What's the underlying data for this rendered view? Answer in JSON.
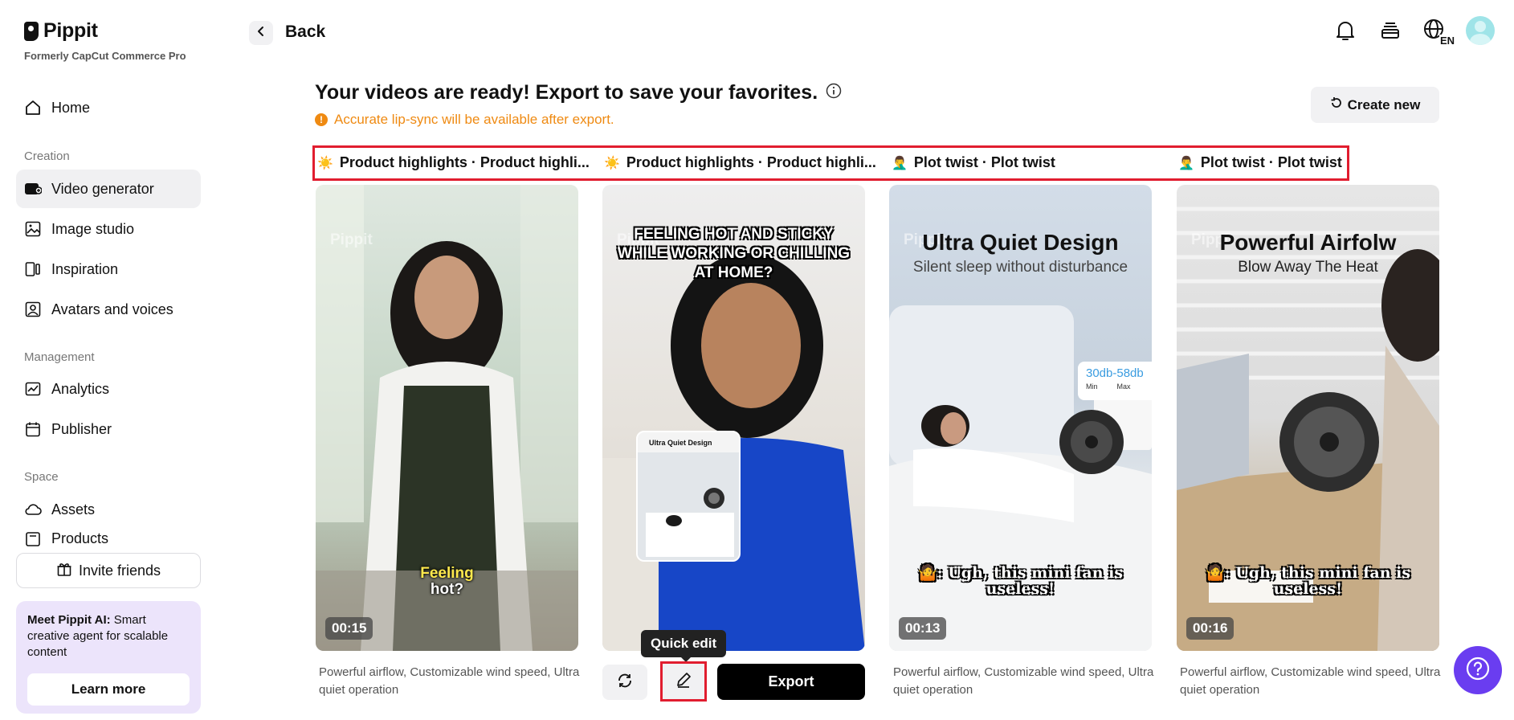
{
  "brand": {
    "name": "Pippit",
    "subtitle": "Formerly CapCut Commerce Pro"
  },
  "sidebar": {
    "items_top": [
      {
        "label": "Home",
        "icon": "home-icon"
      }
    ],
    "sections": [
      {
        "label": "Creation",
        "items": [
          {
            "label": "Video generator",
            "icon": "video-generator-icon",
            "active": true
          },
          {
            "label": "Image studio",
            "icon": "image-studio-icon"
          },
          {
            "label": "Inspiration",
            "icon": "inspiration-icon"
          },
          {
            "label": "Avatars and voices",
            "icon": "avatar-icon"
          }
        ]
      },
      {
        "label": "Management",
        "items": [
          {
            "label": "Analytics",
            "icon": "analytics-icon"
          },
          {
            "label": "Publisher",
            "icon": "calendar-icon"
          }
        ]
      },
      {
        "label": "Space",
        "items": [
          {
            "label": "Assets",
            "icon": "cloud-icon"
          },
          {
            "label": "Products",
            "icon": "products-icon"
          }
        ]
      }
    ],
    "invite_label": "Invite friends",
    "promo": {
      "bold": "Meet Pippit AI:",
      "text": " Smart creative agent for scalable content",
      "button": "Learn more"
    }
  },
  "header": {
    "back_label": "Back",
    "language": "EN"
  },
  "main": {
    "headline": "Your videos are ready! Export to save your favorites.",
    "warning": "Accurate lip-sync will be available after export.",
    "create_new": "Create new",
    "tabs": [
      {
        "emoji": "☀️",
        "label": "Product highlights · Product highli..."
      },
      {
        "emoji": "☀️",
        "label": "Product highlights · Product highli..."
      },
      {
        "emoji": "🤦‍♂️",
        "label": "Plot twist · Plot twist"
      },
      {
        "emoji": "🤦‍♂️",
        "label": "Plot twist · Plot twist"
      }
    ],
    "videos": [
      {
        "duration": "00:15",
        "watermark": "Pippit",
        "subtitle_line1": "Feeling",
        "subtitle_line2": "hot?",
        "description": "Powerful airflow, Customizable wind speed, Ultra quiet operation"
      },
      {
        "watermark": "Pippit",
        "overlay": "FEELING HOT AND STICKY WHILE WORKING OR CHILLING AT HOME?",
        "inset_title": "Ultra Quiet Design",
        "actions": {
          "tooltip": "Quick edit",
          "export": "Export"
        }
      },
      {
        "duration": "00:13",
        "watermark": "Pippit",
        "title": "Ultra Quiet Design",
        "subtitle": "Silent sleep without disturbance",
        "badge": "30db-58db",
        "badge_min": "Min",
        "badge_max": "Max",
        "caption": "🤷: Ugh, this mini fan is useless!",
        "description": "Powerful airflow, Customizable wind speed, Ultra quiet operation"
      },
      {
        "duration": "00:16",
        "watermark": "Pippit",
        "title": "Powerful Airfolw",
        "subtitle": "Blow Away The Heat",
        "caption": "🤷: Ugh, this mini fan is useless!",
        "description": "Powerful airflow, Customizable wind speed, Ultra quiet operation"
      }
    ]
  },
  "colors": {
    "accent_purple": "#6a3df0",
    "warning_orange": "#ef8a12",
    "highlight_red": "#e11d2f"
  }
}
